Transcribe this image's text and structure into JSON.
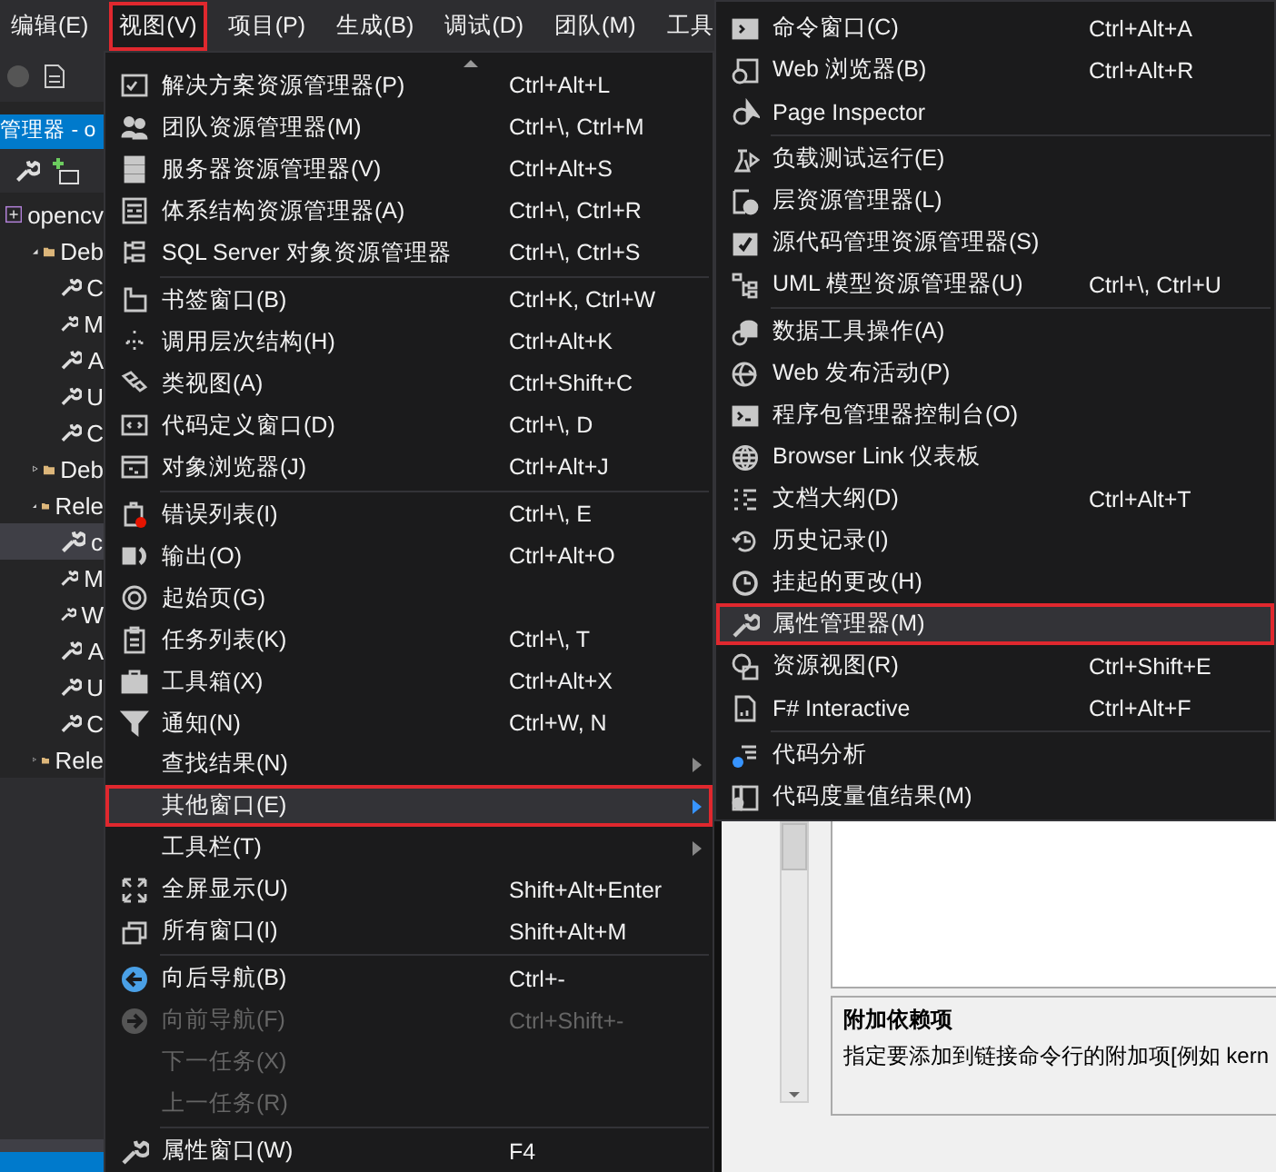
{
  "menubar": [
    {
      "label": "编辑(E)",
      "selected": false
    },
    {
      "label": "视图(V)",
      "selected": true
    },
    {
      "label": "项目(P)",
      "selected": false
    },
    {
      "label": "生成(B)",
      "selected": false
    },
    {
      "label": "调试(D)",
      "selected": false
    },
    {
      "label": "团队(M)",
      "selected": false
    },
    {
      "label": "工具",
      "selected": false
    }
  ],
  "explorer": {
    "title": "管理器 - o",
    "tree": [
      {
        "label": "opencv",
        "kind": "project",
        "selected": false,
        "children": [
          {
            "label": "Deb",
            "kind": "folder",
            "expanded": true,
            "selected": false,
            "children": [
              {
                "label": "C",
                "kind": "sheet",
                "selected": false
              },
              {
                "label": "M",
                "kind": "sheet",
                "selected": false
              },
              {
                "label": "A",
                "kind": "sheet",
                "selected": false
              },
              {
                "label": "U",
                "kind": "sheet",
                "selected": false
              },
              {
                "label": "C",
                "kind": "sheet",
                "selected": false
              }
            ]
          },
          {
            "label": "Deb",
            "kind": "folder",
            "expanded": false,
            "selected": false
          },
          {
            "label": "Rele",
            "kind": "folder",
            "expanded": true,
            "selected": false,
            "children": [
              {
                "label": "c",
                "kind": "sheet",
                "selected": true
              },
              {
                "label": "M",
                "kind": "sheet",
                "selected": false
              },
              {
                "label": "W",
                "kind": "sheet",
                "selected": false
              },
              {
                "label": "A",
                "kind": "sheet",
                "selected": false
              },
              {
                "label": "U",
                "kind": "sheet",
                "selected": false
              },
              {
                "label": "C",
                "kind": "sheet",
                "selected": false
              }
            ]
          },
          {
            "label": "Rele",
            "kind": "folder",
            "expanded": false,
            "selected": false
          }
        ]
      }
    ]
  },
  "view_menu": {
    "groups": [
      [
        {
          "label": "解决方案资源管理器(P)",
          "shortcut": "Ctrl+Alt+L",
          "disabled": false,
          "selected": false,
          "submenu": false
        },
        {
          "label": "团队资源管理器(M)",
          "shortcut": "Ctrl+\\, Ctrl+M",
          "disabled": false,
          "selected": false,
          "submenu": false
        },
        {
          "label": "服务器资源管理器(V)",
          "shortcut": "Ctrl+Alt+S",
          "disabled": false,
          "selected": false,
          "submenu": false
        },
        {
          "label": "体系结构资源管理器(A)",
          "shortcut": "Ctrl+\\, Ctrl+R",
          "disabled": false,
          "selected": false,
          "submenu": false
        },
        {
          "label": "SQL Server 对象资源管理器",
          "shortcut": "Ctrl+\\, Ctrl+S",
          "disabled": false,
          "selected": false,
          "submenu": false
        }
      ],
      [
        {
          "label": "书签窗口(B)",
          "shortcut": "Ctrl+K, Ctrl+W",
          "disabled": false,
          "selected": false,
          "submenu": false
        },
        {
          "label": "调用层次结构(H)",
          "shortcut": "Ctrl+Alt+K",
          "disabled": false,
          "selected": false,
          "submenu": false
        },
        {
          "label": "类视图(A)",
          "shortcut": "Ctrl+Shift+C",
          "disabled": false,
          "selected": false,
          "submenu": false
        },
        {
          "label": "代码定义窗口(D)",
          "shortcut": "Ctrl+\\, D",
          "disabled": false,
          "selected": false,
          "submenu": false
        },
        {
          "label": "对象浏览器(J)",
          "shortcut": "Ctrl+Alt+J",
          "disabled": false,
          "selected": false,
          "submenu": false
        }
      ],
      [
        {
          "label": "错误列表(I)",
          "shortcut": "Ctrl+\\, E",
          "disabled": false,
          "selected": false,
          "submenu": false
        },
        {
          "label": "输出(O)",
          "shortcut": "Ctrl+Alt+O",
          "disabled": false,
          "selected": false,
          "submenu": false
        },
        {
          "label": "起始页(G)",
          "disabled": false,
          "selected": false,
          "submenu": false
        },
        {
          "label": "任务列表(K)",
          "shortcut": "Ctrl+\\, T",
          "disabled": false,
          "selected": false,
          "submenu": false
        },
        {
          "label": "工具箱(X)",
          "shortcut": "Ctrl+Alt+X",
          "disabled": false,
          "selected": false,
          "submenu": false
        },
        {
          "label": "通知(N)",
          "shortcut": "Ctrl+W, N",
          "disabled": false,
          "selected": false,
          "submenu": false
        },
        {
          "label": "查找结果(N)",
          "disabled": false,
          "selected": false,
          "submenu": true
        },
        {
          "label": "其他窗口(E)",
          "disabled": false,
          "selected": true,
          "submenu": true
        },
        {
          "label": "工具栏(T)",
          "disabled": false,
          "selected": false,
          "submenu": true
        },
        {
          "label": "全屏显示(U)",
          "shortcut": "Shift+Alt+Enter",
          "disabled": false,
          "selected": false,
          "submenu": false
        },
        {
          "label": "所有窗口(I)",
          "shortcut": "Shift+Alt+M",
          "disabled": false,
          "selected": false,
          "submenu": false
        }
      ],
      [
        {
          "label": "向后导航(B)",
          "shortcut": "Ctrl+-",
          "disabled": false,
          "selected": false,
          "submenu": false
        },
        {
          "label": "向前导航(F)",
          "shortcut": "Ctrl+Shift+-",
          "disabled": true,
          "selected": false,
          "submenu": false
        },
        {
          "label": "下一任务(X)",
          "disabled": true,
          "selected": false,
          "submenu": false
        },
        {
          "label": "上一任务(R)",
          "disabled": true,
          "selected": false,
          "submenu": false
        }
      ],
      [
        {
          "label": "属性窗口(W)",
          "shortcut": "F4",
          "disabled": false,
          "selected": false,
          "submenu": false
        }
      ]
    ]
  },
  "other_windows_menu": {
    "groups": [
      [
        {
          "label": "命令窗口(C)",
          "shortcut": "Ctrl+Alt+A",
          "selected": false
        },
        {
          "label": "Web 浏览器(B)",
          "shortcut": "Ctrl+Alt+R",
          "selected": false
        },
        {
          "label": "Page Inspector",
          "selected": false
        }
      ],
      [
        {
          "label": "负载测试运行(E)",
          "selected": false
        },
        {
          "label": "层资源管理器(L)",
          "selected": false
        },
        {
          "label": "源代码管理资源管理器(S)",
          "selected": false
        },
        {
          "label": "UML 模型资源管理器(U)",
          "shortcut": "Ctrl+\\, Ctrl+U",
          "selected": false
        }
      ],
      [
        {
          "label": "数据工具操作(A)",
          "selected": false
        },
        {
          "label": "Web 发布活动(P)",
          "selected": false
        },
        {
          "label": "程序包管理器控制台(O)",
          "selected": false
        },
        {
          "label": "Browser Link 仪表板",
          "selected": false
        },
        {
          "label": "文档大纲(D)",
          "shortcut": "Ctrl+Alt+T",
          "selected": false
        },
        {
          "label": "历史记录(I)",
          "selected": false
        },
        {
          "label": "挂起的更改(H)",
          "selected": false
        },
        {
          "label": "属性管理器(M)",
          "selected": true
        },
        {
          "label": "资源视图(R)",
          "shortcut": "Ctrl+Shift+E",
          "selected": false
        },
        {
          "label": "F# Interactive",
          "shortcut": "Ctrl+Alt+F",
          "selected": false
        }
      ],
      [
        {
          "label": "代码分析",
          "selected": false
        },
        {
          "label": "代码度量值结果(M)",
          "selected": false
        }
      ]
    ]
  },
  "property_dialog": {
    "heading": "附加依赖项",
    "description": "指定要添加到链接命令行的附加项[例如 kern"
  }
}
